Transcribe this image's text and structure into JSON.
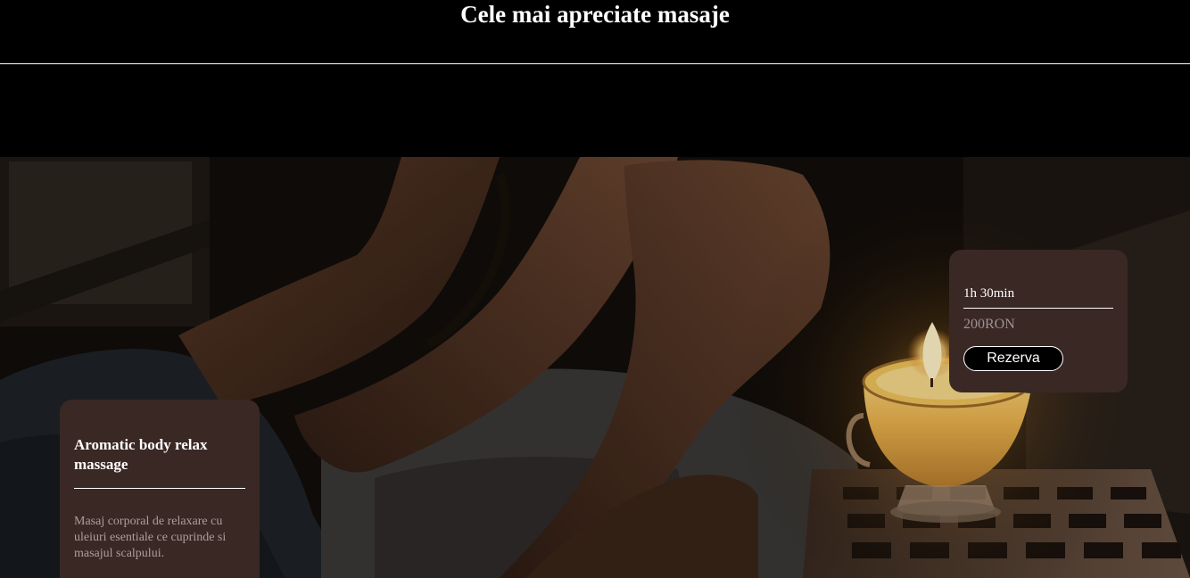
{
  "section": {
    "title": "Cele mai apreciate masaje"
  },
  "hero": {
    "image": "foot-massage-with-candle-photo"
  },
  "massage_card": {
    "title": "Aromatic body relax massage",
    "description": "Masaj corporal de relaxare cu uleiuri esentiale ce cuprinde si masajul scalpului."
  },
  "booking_card": {
    "duration": "1h 30min",
    "price": "200RON",
    "button_label": "Rezerva"
  },
  "colors": {
    "background": "#000000",
    "card": "#3a2825",
    "text": "#ffffff",
    "muted_text": "#a99f9c"
  }
}
